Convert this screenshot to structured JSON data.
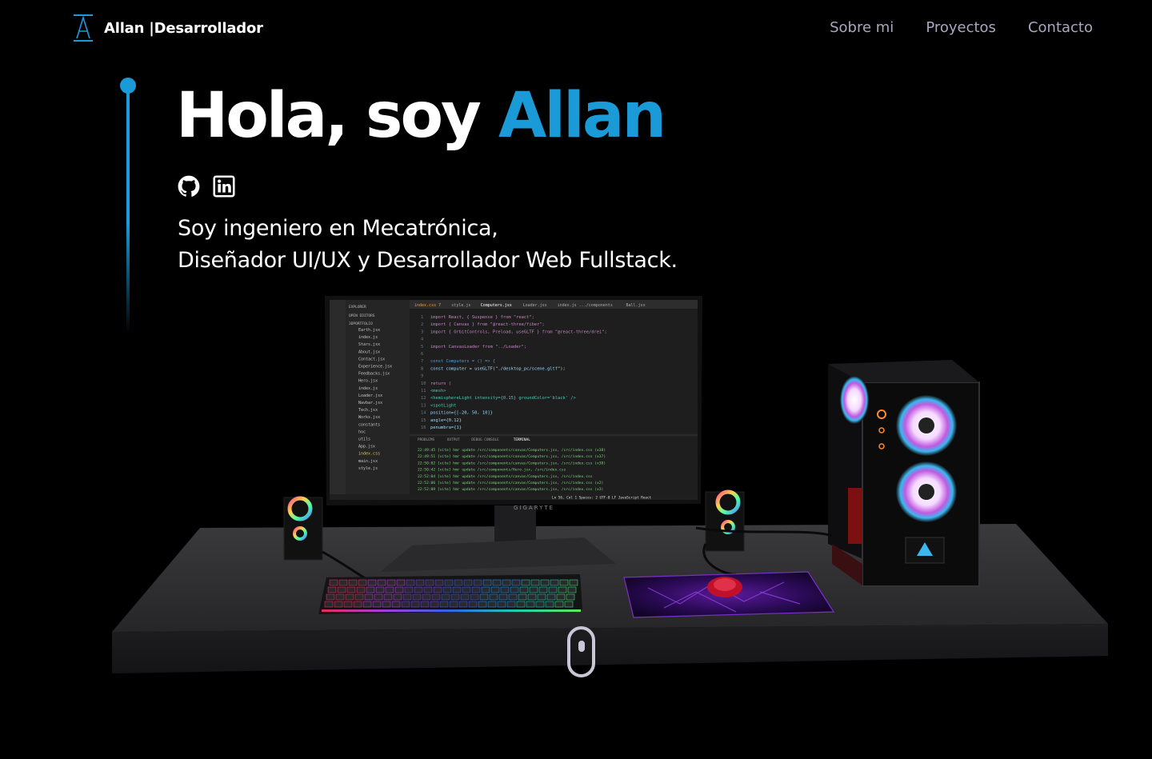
{
  "nav": {
    "logo_letter": "A",
    "brand": "Allan |Desarrollador",
    "links": [
      "Sobre mi",
      "Proyectos",
      "Contacto"
    ]
  },
  "hero": {
    "title_prefix": "Hola, soy ",
    "title_accent": "Allan",
    "subtitle_line1": "Soy ingeniero en Mecatrónica,",
    "subtitle_line2": "Diseñador UI/UX y Desarrollador Web Fullstack."
  },
  "socials": [
    {
      "icon": "github-icon"
    },
    {
      "icon": "linkedin-icon"
    }
  ],
  "monitor": {
    "brand": "GIGARYTE",
    "tabs": [
      "index.css 7",
      "style.js",
      "Computers.jsx",
      "Loader.jsx",
      "index.js .../components",
      "Ball.jsx"
    ],
    "code_lines": [
      "import React, { Suspense } from \"react\";",
      "import { Canvas } from \"@react-three/fiber\";",
      "import { OrbitControls, Preload, useGLTF } from \"@react-three/drei\";",
      "",
      "import CanvasLoader from \"../Loader\";",
      "",
      "const Computers = () => {",
      "  const computer = useGLTF(\"./desktop_pc/scene.gltf\");",
      "",
      "  return (",
      "    <mesh>",
      "      <hemisphereLight intensity={0.15} groundColor='black' />",
      "      <spotLight",
      "        position={[-20, 50, 10]}",
      "        angle={0.12}",
      "        penumbra={1}"
    ],
    "files": [
      "Earth.jsx",
      "index.js",
      "Stars.jsx",
      "About.jsx",
      "Contact.jsx",
      "Experience.jsx",
      "Feedbacks.jsx",
      "Hero.jsx",
      "index.js",
      "Loader.jsx",
      "Navbar.jsx",
      "Tech.jsx",
      "Works.jsx",
      "constants",
      "hoc",
      "utils",
      "App.jsx",
      "index.css",
      "main.jsx",
      "style.js"
    ],
    "terminal_tabs": [
      "PROBLEMS",
      "OUTPUT",
      "DEBUG CONSOLE",
      "TERMINAL"
    ],
    "terminal_lines": [
      "22:49:45 [vite] hmr update /src/components/canvas/Computers.jsx, /src/index.css (x38)",
      "22:49:51 [vite] hmr update /src/components/canvas/Computers.jsx, /src/index.css (x37)",
      "22:50:02 [vite] hmr update /src/components/canvas/Computers.jsx, /src/index.css (x38)",
      "22:50:42 [vite] hmr update /src/components/Hero.jsx, /src/index.css",
      "22:52:04 [vite] hmr update /src/components/canvas/Computers.jsx, /src/index.css",
      "22:52:06 [vite] hmr update /src/components/canvas/Computers.jsx, /src/index.css (x2)",
      "22:52:09 [vite] hmr update /src/components/canvas/Computers.jsx, /src/index.css (x3)"
    ],
    "status": "Ln 56, Col 1   Spaces: 2   UTF-8   LF   JavaScript React"
  },
  "colors": {
    "accent": "#1b9ad8",
    "nav_link": "#aaa6c3",
    "background": "#000000",
    "scroll_indicator": "#c8c6d8"
  }
}
